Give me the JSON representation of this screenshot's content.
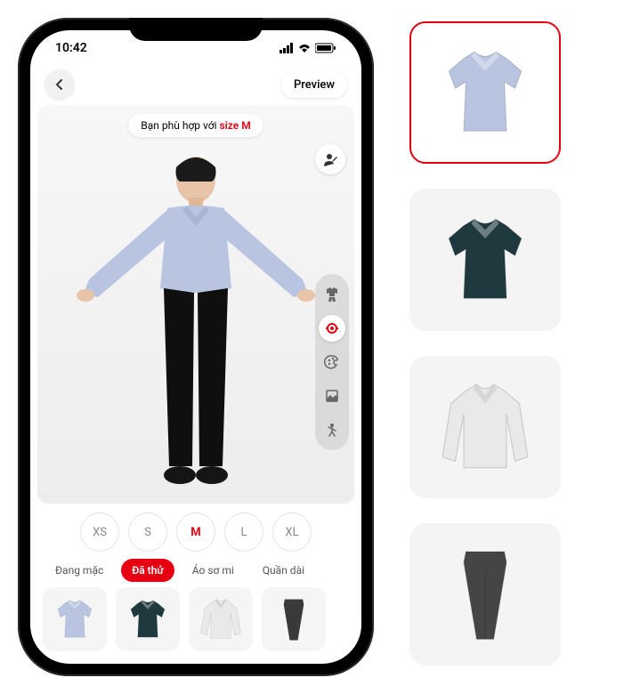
{
  "status": {
    "time": "10:42"
  },
  "topbar": {
    "preview_label": "Preview"
  },
  "fit": {
    "prefix": "Bạn phù hợp với ",
    "highlight": "size M"
  },
  "sizes": [
    "XS",
    "S",
    "M",
    "L",
    "XL"
  ],
  "size_selected_index": 2,
  "categories": [
    {
      "label": "Đang mặc"
    },
    {
      "label": "Đã thử"
    },
    {
      "label": "Áo sơ mi"
    },
    {
      "label": "Quần dài"
    }
  ],
  "category_selected_index": 1,
  "tray_items": [
    {
      "name": "shirt-blue",
      "kind": "short_shirt",
      "color": "#b8c4e0"
    },
    {
      "name": "shirt-plaid",
      "kind": "short_shirt",
      "color": "#1e3a3f"
    },
    {
      "name": "shirt-white",
      "kind": "long_shirt",
      "color": "#e9e9e9"
    },
    {
      "name": "pants-dark",
      "kind": "pants",
      "color": "#3a3a3a"
    }
  ],
  "side_thumbs": [
    {
      "name": "thumb-shirt-blue",
      "kind": "short_shirt",
      "color": "#b8c4e0",
      "selected": true
    },
    {
      "name": "thumb-shirt-plaid",
      "kind": "short_shirt",
      "color": "#1e3a3f",
      "selected": false
    },
    {
      "name": "thumb-shirt-white",
      "kind": "long_shirt",
      "color": "#e9e9e9",
      "selected": false
    },
    {
      "name": "thumb-pants-dark",
      "kind": "pants",
      "color": "#454545",
      "selected": false
    }
  ],
  "rail": [
    {
      "name": "outfit-icon",
      "active": false
    },
    {
      "name": "measure-icon",
      "active": true
    },
    {
      "name": "palette-icon",
      "active": false
    },
    {
      "name": "background-icon",
      "active": false
    },
    {
      "name": "pose-icon",
      "active": false
    }
  ]
}
